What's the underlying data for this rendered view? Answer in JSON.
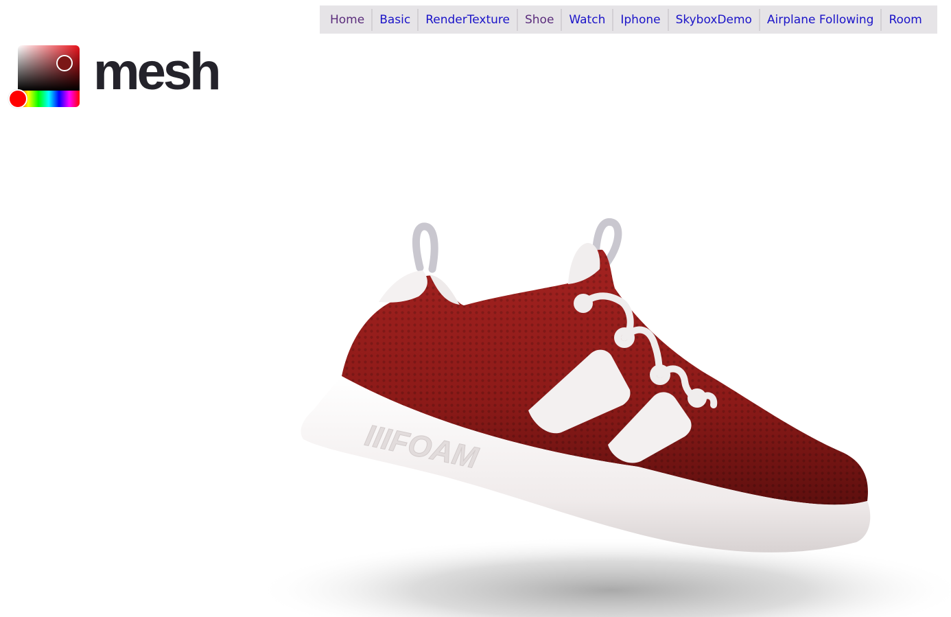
{
  "nav": {
    "items": [
      {
        "label": "Home",
        "visited": true
      },
      {
        "label": "Basic",
        "visited": false
      },
      {
        "label": "RenderTexture",
        "visited": false
      },
      {
        "label": "Shoe",
        "visited": true
      },
      {
        "label": "Watch",
        "visited": false
      },
      {
        "label": "Iphone",
        "visited": false
      },
      {
        "label": "SkyboxDemo",
        "visited": false
      },
      {
        "label": "Airplane Following",
        "visited": false
      },
      {
        "label": "Room",
        "visited": false
      }
    ]
  },
  "logo": {
    "text": "mesh"
  },
  "color_picker": {
    "selected_color": "#7b1716",
    "hue_color": "#ff0000"
  },
  "shoe": {
    "upper_color": "#8c1a18",
    "sole_color": "#f2eeee",
    "sole_text": "IIIFOAM"
  },
  "colors": {
    "nav_bg": "#e6e4e7",
    "link": "#1a13c8",
    "visited_link": "#5b2d7c",
    "logo_text": "#24232b"
  }
}
